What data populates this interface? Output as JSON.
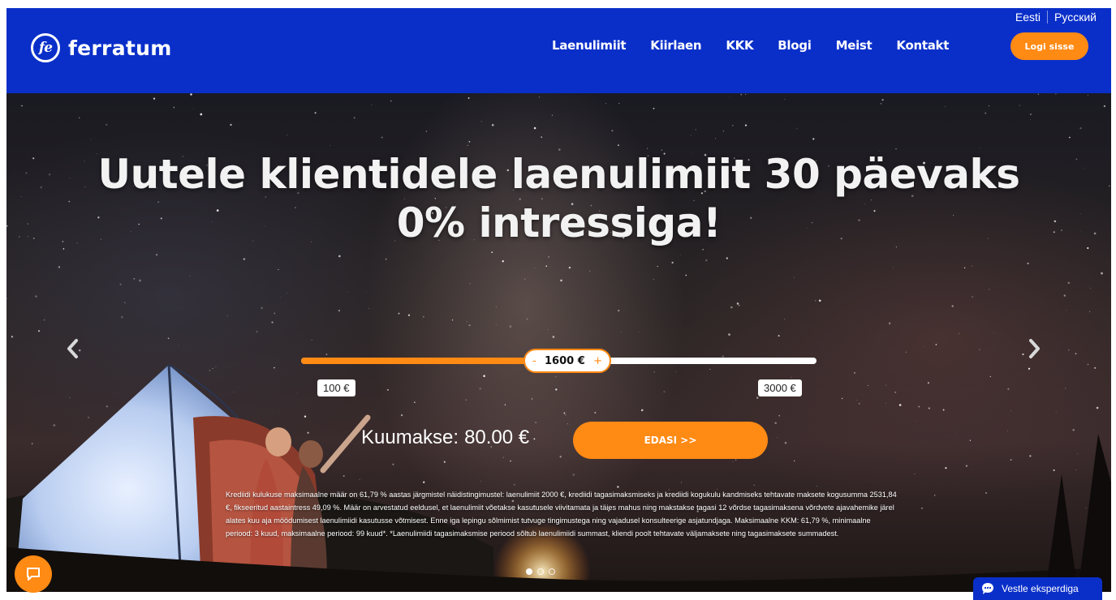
{
  "header": {
    "logo_mark": "fe",
    "logo_text": "ferratum",
    "languages": [
      "Eesti",
      "Русский"
    ],
    "nav": [
      "Laenulimiit",
      "Kiirlaen",
      "KKK",
      "Blogi",
      "Meist",
      "Kontakt"
    ],
    "login_label": "Logi sisse"
  },
  "hero": {
    "title_line1": "Uutele klientidele laenulimiit 30 päevaks",
    "title_line2": "0% intressiga!",
    "slider": {
      "min_label": "100 €",
      "max_label": "3000 €",
      "min": 100,
      "max": 3000,
      "value": 1600,
      "value_label": "1600 €",
      "minus": "-",
      "plus": "+"
    },
    "monthly_label": "Kuumakse:",
    "monthly_value": "80.00 €",
    "cta_label": "EDASI >>",
    "disclaimer": "Krediidi kulukuse maksimaalne määr on 61,79 % aastas järgmistel näidistingimustel: laenulimiit 2000 €, krediidi tagasimaksmiseks ja krediidi kogukulu kandmiseks tehtavate maksete kogusumma 2531,84 €, fikseeritud aastaintress 49,09 %. Määr on arvestatud eeldusel, et laenulimiit võetakse kasutusele viivitamata ja täies mahus ning makstakse tagasi 12 võrdse tagasimaksena võrdvete ajavahemike järel alates kuu aja möödumisest laenulimiidi kasutusse võtmisest. Enne iga lepingu sõlmimist tutvuge tingimustega ning vajadusel konsulteerige asjatundjaga. Maksimaalne KKM: 61,79 %, minimaalne periood: 3 kuud, maksimaalne periood: 99 kuud*. *Laenulimiidi tagasimaksmise periood sõltub laenulimiidi summast, kliendi poolt tehtavate väljamaksete ning tagasimaksete summadest."
  },
  "carousel": {
    "slides": 3,
    "active": 0
  },
  "chat": {
    "expert_label": "Vestle eksperdiga"
  },
  "icons": {
    "chat": "chat-bubble-icon",
    "prev": "chevron-left-icon",
    "next": "chevron-right-icon",
    "expert": "message-dots-icon"
  },
  "colors": {
    "brand_blue": "#0a2fc9",
    "accent_orange": "#ff8a14",
    "white": "#ffffff"
  }
}
